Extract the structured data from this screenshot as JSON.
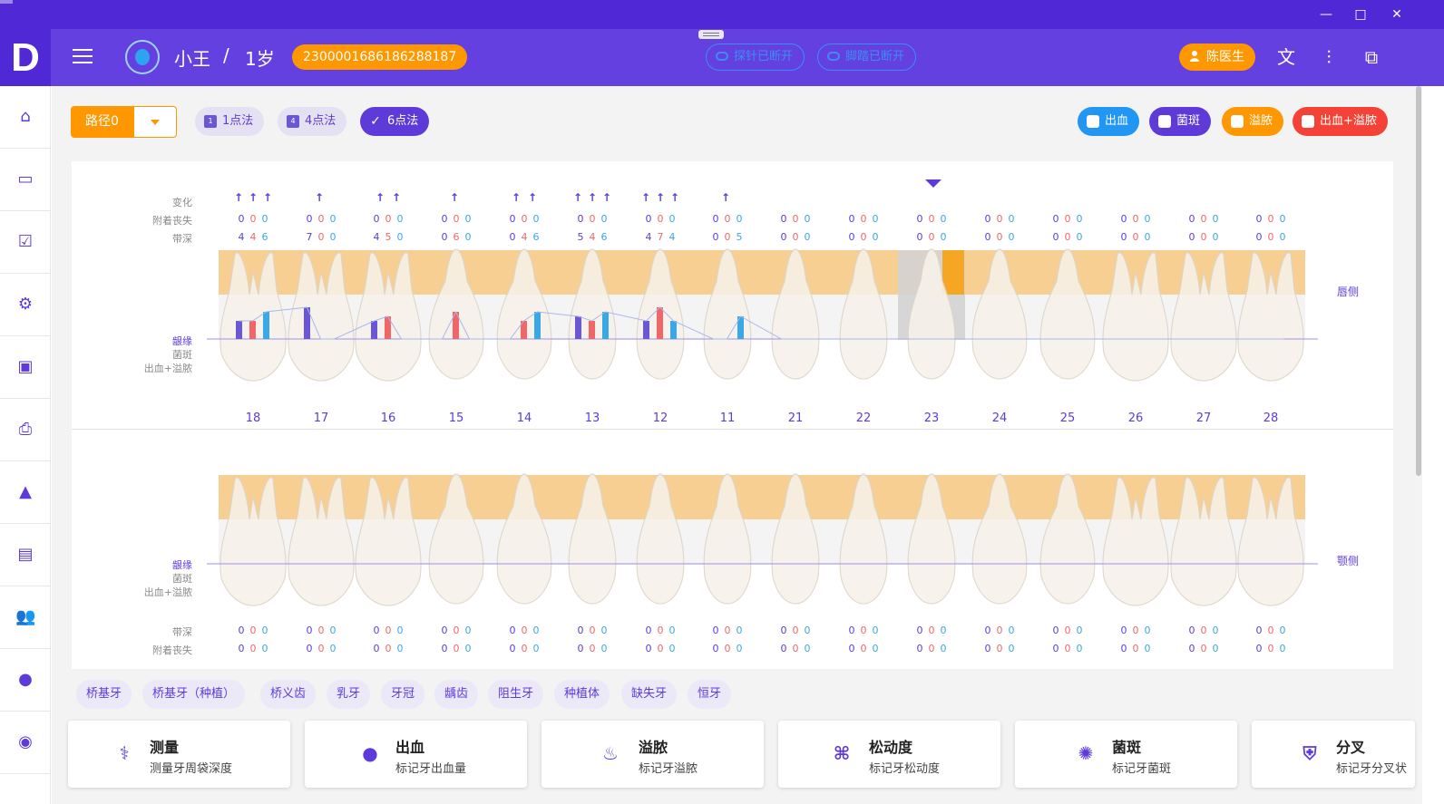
{
  "app": {
    "logo": "D"
  },
  "header": {
    "patient_name": "小王",
    "separator": "/",
    "patient_age": "1岁",
    "patient_id": "2300001686186288187",
    "probe_status": "探针已断开",
    "pedal_status": "脚踏已断开",
    "doctor": "陈医生"
  },
  "toolbar": {
    "route": "路径0",
    "methods": [
      "1点法",
      "4点法",
      "6点法"
    ],
    "legend": [
      {
        "label": "出血",
        "color": "#2196f3"
      },
      {
        "label": "菌斑",
        "color": "#5e3bd9"
      },
      {
        "label": "溢脓",
        "color": "#ff9800"
      },
      {
        "label": "出血+溢脓",
        "color": "#f44336"
      }
    ]
  },
  "upper": {
    "row_labels": {
      "change": "变化",
      "attachment_loss": "附着丧失",
      "pocket_depth": "带深"
    },
    "side_labels": {
      "gingival_margin": "龈缘",
      "plaque": "菌斑",
      "bleeding_suppuration": "出血+溢脓"
    },
    "side": "唇侧",
    "tooth_numbers": [
      "18",
      "17",
      "16",
      "15",
      "14",
      "13",
      "12",
      "11",
      "21",
      "22",
      "23",
      "24",
      "25",
      "26",
      "27",
      "28"
    ],
    "attachment_loss": [
      [
        "0",
        "0",
        "0"
      ],
      [
        "0",
        "0",
        "0"
      ],
      [
        "0",
        "0",
        "0"
      ],
      [
        "0",
        "0",
        "0"
      ],
      [
        "0",
        "0",
        "0"
      ],
      [
        "0",
        "0",
        "0"
      ],
      [
        "0",
        "0",
        "0"
      ],
      [
        "0",
        "0",
        "0"
      ],
      [
        "0",
        "0",
        "0"
      ],
      [
        "0",
        "0",
        "0"
      ],
      [
        "0",
        "0",
        "0"
      ],
      [
        "0",
        "0",
        "0"
      ],
      [
        "0",
        "0",
        "0"
      ],
      [
        "0",
        "0",
        "0"
      ],
      [
        "0",
        "0",
        "0"
      ],
      [
        "0",
        "0",
        "0"
      ]
    ],
    "pocket_depth": [
      [
        "4",
        "4",
        "6"
      ],
      [
        "7",
        "0",
        "0"
      ],
      [
        "4",
        "5",
        "0"
      ],
      [
        "0",
        "6",
        "0"
      ],
      [
        "0",
        "4",
        "6"
      ],
      [
        "5",
        "4",
        "6"
      ],
      [
        "4",
        "7",
        "4"
      ],
      [
        "0",
        "0",
        "5"
      ],
      [
        "0",
        "0",
        "0"
      ],
      [
        "0",
        "0",
        "0"
      ],
      [
        "0",
        "0",
        "0"
      ],
      [
        "0",
        "0",
        "0"
      ],
      [
        "0",
        "0",
        "0"
      ],
      [
        "0",
        "0",
        "0"
      ],
      [
        "0",
        "0",
        "0"
      ],
      [
        "0",
        "0",
        "0"
      ]
    ],
    "change_arrows": [
      3,
      1,
      2,
      1,
      2,
      3,
      3,
      1,
      0,
      0,
      0,
      0,
      0,
      0,
      0,
      0
    ],
    "arrow_glyph": "↑"
  },
  "lower": {
    "row_labels": {
      "pocket_depth": "带深",
      "attachment_loss": "附着丧失"
    },
    "side_labels": {
      "gingival_margin": "龈缘",
      "plaque": "菌斑",
      "bleeding_suppuration": "出血+溢脓"
    },
    "side": "颚侧",
    "pocket_depth": [
      [
        "0",
        "0",
        "0"
      ],
      [
        "0",
        "0",
        "0"
      ],
      [
        "0",
        "0",
        "0"
      ],
      [
        "0",
        "0",
        "0"
      ],
      [
        "0",
        "0",
        "0"
      ],
      [
        "0",
        "0",
        "0"
      ],
      [
        "0",
        "0",
        "0"
      ],
      [
        "0",
        "0",
        "0"
      ],
      [
        "0",
        "0",
        "0"
      ],
      [
        "0",
        "0",
        "0"
      ],
      [
        "0",
        "0",
        "0"
      ],
      [
        "0",
        "0",
        "0"
      ],
      [
        "0",
        "0",
        "0"
      ],
      [
        "0",
        "0",
        "0"
      ],
      [
        "0",
        "0",
        "0"
      ],
      [
        "0",
        "0",
        "0"
      ]
    ],
    "attachment_loss": [
      [
        "0",
        "0",
        "0"
      ],
      [
        "0",
        "0",
        "0"
      ],
      [
        "0",
        "0",
        "0"
      ],
      [
        "0",
        "0",
        "0"
      ],
      [
        "0",
        "0",
        "0"
      ],
      [
        "0",
        "0",
        "0"
      ],
      [
        "0",
        "0",
        "0"
      ],
      [
        "0",
        "0",
        "0"
      ],
      [
        "0",
        "0",
        "0"
      ],
      [
        "0",
        "0",
        "0"
      ],
      [
        "0",
        "0",
        "0"
      ],
      [
        "0",
        "0",
        "0"
      ],
      [
        "0",
        "0",
        "0"
      ],
      [
        "0",
        "0",
        "0"
      ],
      [
        "0",
        "0",
        "0"
      ],
      [
        "0",
        "0",
        "0"
      ]
    ]
  },
  "tooth_types": [
    "桥基牙",
    "桥基牙（种植）",
    "桥义齿",
    "乳牙",
    "牙冠",
    "龋齿",
    "阻生牙",
    "种植体",
    "缺失牙",
    "恒牙"
  ],
  "functions": [
    {
      "title": "测量",
      "desc": "测量牙周袋深度",
      "icon": "syringe-icon"
    },
    {
      "title": "出血",
      "desc": "标记牙出血量",
      "icon": "blood-drop-icon"
    },
    {
      "title": "溢脓",
      "desc": "标记牙溢脓",
      "icon": "suppuration-icon"
    },
    {
      "title": "松动度",
      "desc": "标记牙松动度",
      "icon": "tooth-mobility-icon"
    },
    {
      "title": "菌斑",
      "desc": "标记牙菌斑",
      "icon": "bacteria-icon"
    },
    {
      "title": "分叉",
      "desc": "标记牙分叉状",
      "icon": "shield-icon"
    }
  ],
  "colors": {
    "plaque": "#6b56d6",
    "bleeding": "#f06767",
    "suppuration": "#3aa7e7",
    "band": "#f7c77f",
    "selected": "#f5a623"
  }
}
